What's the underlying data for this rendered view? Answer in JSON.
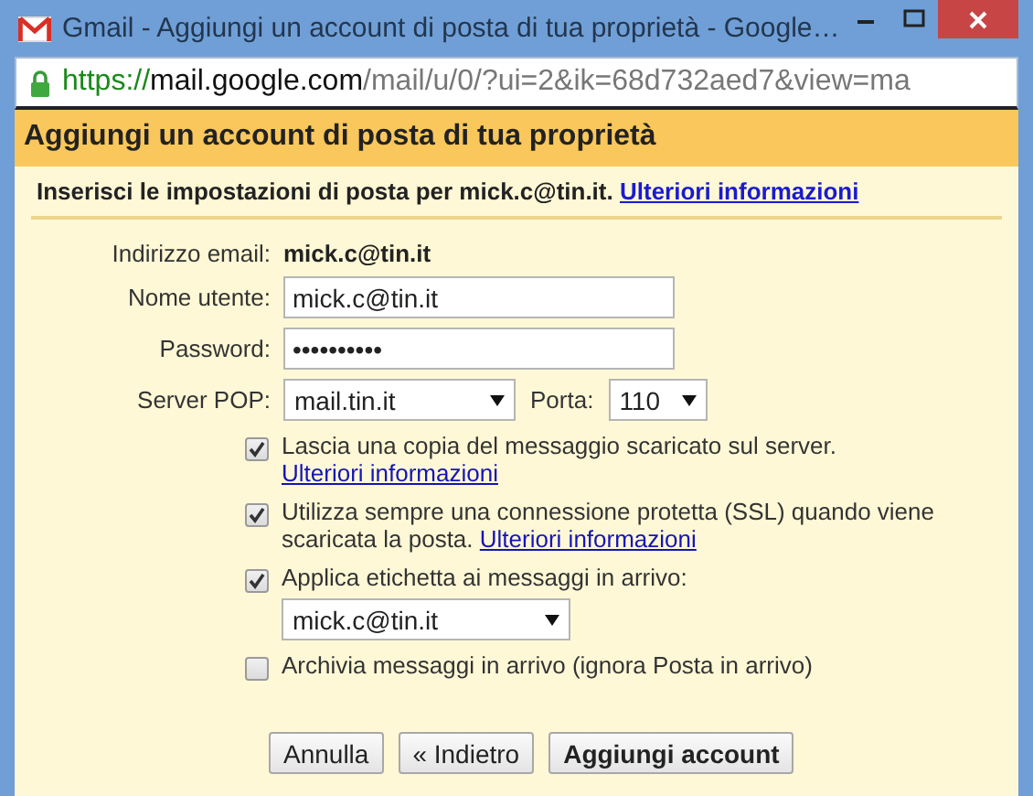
{
  "window": {
    "title": "Gmail - Aggiungi un account di posta di tua proprietà - Google…"
  },
  "address_bar": {
    "secure": true,
    "scheme": "https://",
    "host": "mail.google.com",
    "path": "/mail/u/0/?ui=2&ik=68d732aed7&view=ma"
  },
  "dialog": {
    "title": "Aggiungi un account di posta di tua proprietà",
    "intro": "Inserisci le impostazioni di posta per mick.c@tin.it.",
    "intro_link": "Ulteriori informazioni",
    "fields": [
      {
        "kind": "static",
        "label": "Indirizzo email:",
        "value": "mick.c@tin.it"
      },
      {
        "kind": "text",
        "label": "Nome utente:",
        "value": "mick.c@tin.it"
      },
      {
        "kind": "password",
        "label": "Password:",
        "value": "••••••••••"
      }
    ],
    "server": {
      "label": "Server POP:",
      "value": "mail.tin.it",
      "port_label": "Porta:",
      "port": "110"
    },
    "options": [
      {
        "checked": true,
        "text": "Lascia una copia del messaggio scaricato sul server.",
        "link": "Ulteriori informazioni"
      },
      {
        "checked": true,
        "text": "Utilizza sempre una connessione protetta (SSL) quando viene scaricata la posta.",
        "link": "Ulteriori informazioni"
      },
      {
        "checked": true,
        "text": "Applica etichetta ai messaggi in arrivo:",
        "select": "mick.c@tin.it"
      },
      {
        "checked": false,
        "text": "Archivia messaggi in arrivo (ignora Posta in arrivo)"
      }
    ],
    "buttons": [
      {
        "label": "Annulla",
        "primary": false
      },
      {
        "label": "« Indietro",
        "primary": false
      },
      {
        "label": "Aggiungi account",
        "primary": true
      }
    ]
  }
}
